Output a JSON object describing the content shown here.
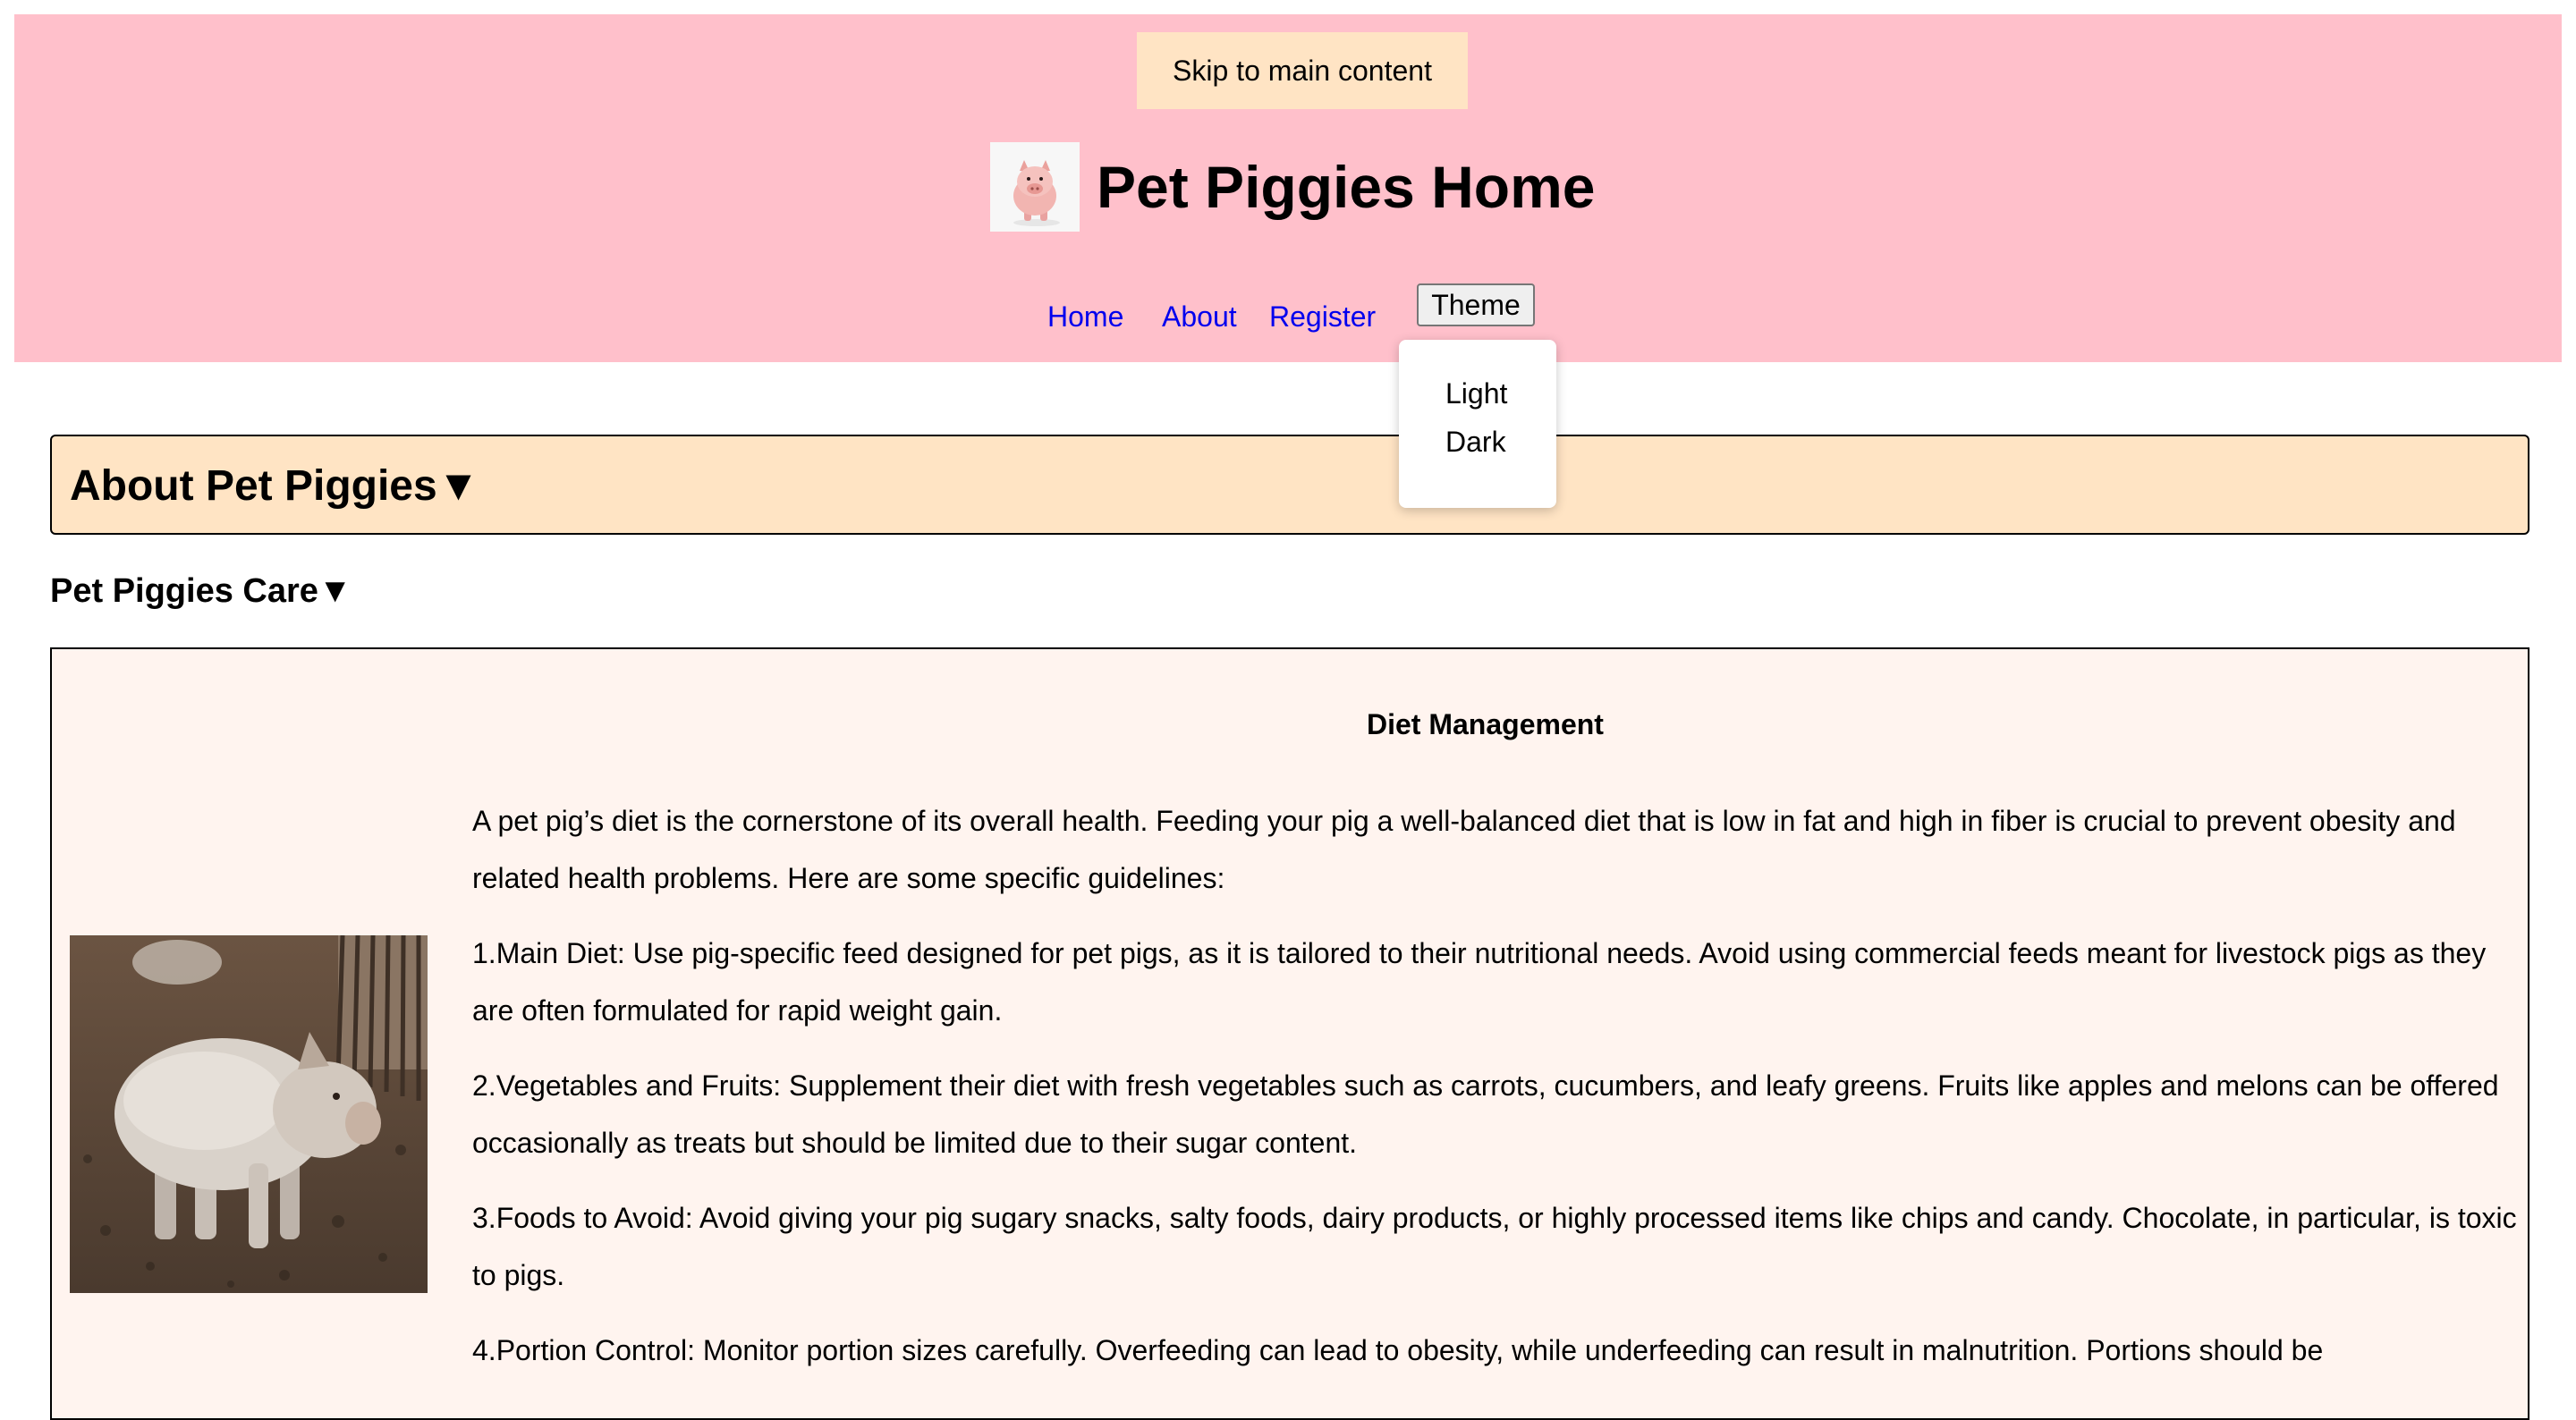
{
  "header": {
    "skip_link": "Skip to main content",
    "site_title": "Pet Piggies Home",
    "logo_icon": "piggy-bank-icon",
    "nav": {
      "home": "Home",
      "about": "About",
      "register": "Register",
      "theme_button": "Theme"
    },
    "theme_menu": {
      "options": [
        "Light",
        "Dark"
      ]
    }
  },
  "about_section": {
    "summary": "About Pet Piggies▼"
  },
  "care_section": {
    "summary": "Pet Piggies Care▼",
    "heading": "Diet Management",
    "image_icon": "pig-photo",
    "paragraphs": [
      "A pet pig’s diet is the cornerstone of its overall health. Feeding your pig a well-balanced diet that is low in fat and high in fiber is crucial to prevent obesity and related health problems. Here are some specific guidelines:",
      "1.Main Diet: Use pig-specific feed designed for pet pigs, as it is tailored to their nutritional needs. Avoid using commercial feeds meant for livestock pigs as they are often formulated for rapid weight gain.",
      "2.Vegetables and Fruits: Supplement their diet with fresh vegetables such as carrots, cucumbers, and leafy greens. Fruits like apples and melons can be offered occasionally as treats but should be limited due to their sugar content.",
      "3.Foods to Avoid: Avoid giving your pig sugary snacks, salty foods, dairy products, or highly processed items like chips and candy. Chocolate, in particular, is toxic to pigs.",
      "4.Portion Control: Monitor portion sizes carefully. Overfeeding can lead to obesity, while underfeeding can result in malnutrition. Portions should be"
    ]
  },
  "colors": {
    "header_bg": "#ffc0cb",
    "accent_bg": "#ffe4c4",
    "panel_bg": "#fff4ef",
    "link": "#0000ee"
  }
}
